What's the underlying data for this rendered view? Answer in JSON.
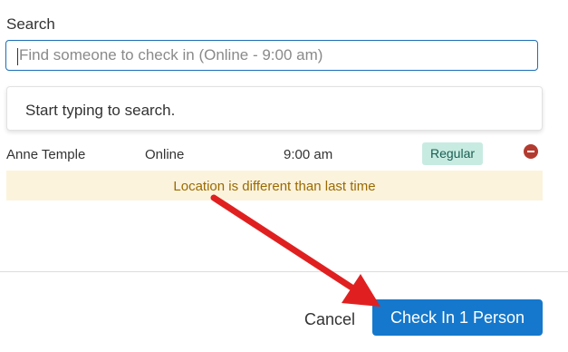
{
  "search": {
    "label": "Search",
    "placeholder": "Find someone to check in (Online - 9:00 am)",
    "value": ""
  },
  "dropdown": {
    "message": "Start typing to search."
  },
  "person": {
    "name": "Anne Temple",
    "location": "Online",
    "time": "9:00 am",
    "badge": "Regular",
    "remove_icon": "minus-circle-icon"
  },
  "warning": {
    "message": "Location is different than last time"
  },
  "footer": {
    "cancel_label": "Cancel",
    "submit_label": "Check In 1 Person"
  },
  "annotation": {
    "arrow_color": "#e02020"
  },
  "colors": {
    "primary": "#1578cc",
    "badge_bg": "#c8ebe1",
    "warning_bg": "#fcf3dd",
    "warning_text": "#9a6a00",
    "remove_icon": "#b33a2f"
  }
}
